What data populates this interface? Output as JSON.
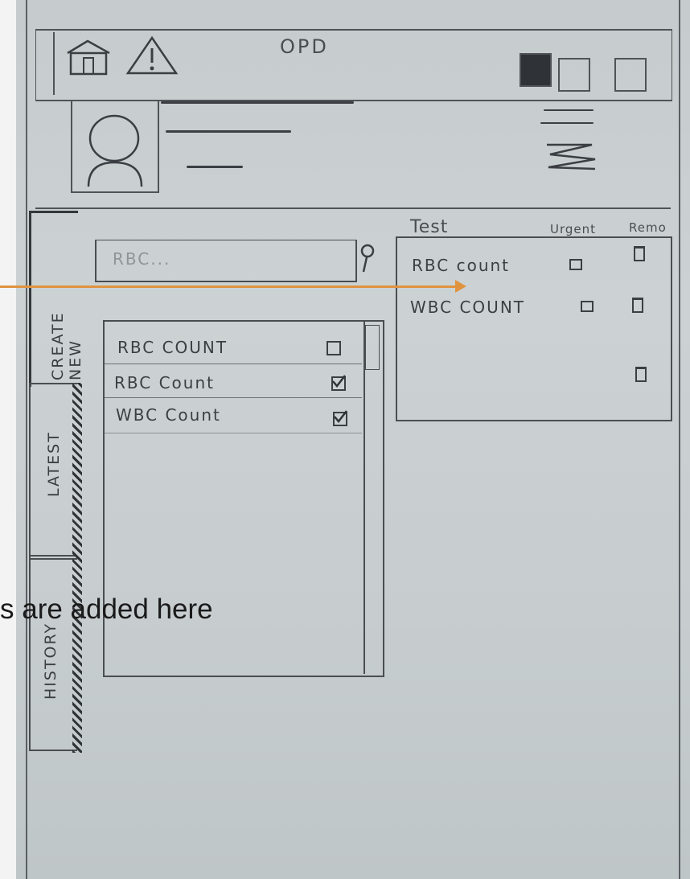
{
  "header": {
    "title": "OPD",
    "left_icons": [
      "home-icon",
      "warning-icon"
    ],
    "right_controls": [
      "window-control-1",
      "window-control-2",
      "window-control-3"
    ]
  },
  "patient_card": {
    "avatar": "avatar-icon"
  },
  "tabs": [
    {
      "label": "CREATE NEW",
      "active": true
    },
    {
      "label": "LATEST",
      "active": false
    },
    {
      "label": "HISTORY",
      "active": false
    }
  ],
  "search": {
    "placeholder": "RBC..."
  },
  "results_list": {
    "items": [
      {
        "label": "RBC COUNT",
        "checked": false
      },
      {
        "label": "RBC Count",
        "checked": true
      },
      {
        "label": "WBC Count",
        "checked": true
      }
    ]
  },
  "tests_table": {
    "headers": [
      "Test",
      "Urgent",
      "Remo"
    ],
    "rows": [
      {
        "label": "RBC count"
      },
      {
        "label": "WBC COUNT"
      },
      {
        "label": ""
      }
    ]
  },
  "annotation": {
    "text": "s are added here",
    "color": "#e0933f"
  }
}
